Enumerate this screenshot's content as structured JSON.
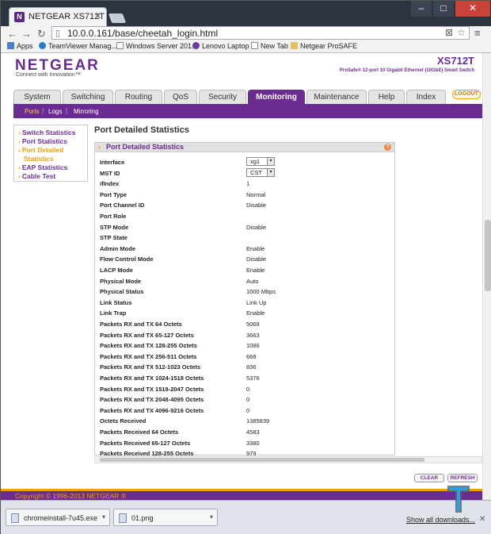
{
  "browser": {
    "tab_title": "NETGEAR XS712T",
    "url": "10.0.0.161/base/cheetah_login.html",
    "bookmarks": [
      "Apps",
      "TeamViewer Manag...",
      "Windows Server 201...",
      "Lenovo Laptop",
      "New Tab",
      "Netgear ProSAFE"
    ]
  },
  "header": {
    "logo": "NETGEAR",
    "tagline": "Connect with Innovation™",
    "model": "XS712T",
    "model_desc": "ProSafe® 12-port 10 Gigabit Ethernet (10GbE) Smart Switch",
    "logout": "LOGOUT"
  },
  "main_tabs": [
    {
      "label": "System"
    },
    {
      "label": "Switching"
    },
    {
      "label": "Routing"
    },
    {
      "label": "QoS"
    },
    {
      "label": "Security"
    },
    {
      "label": "Monitoring"
    },
    {
      "label": "Maintenance"
    },
    {
      "label": "Help"
    },
    {
      "label": "Index"
    }
  ],
  "sub_nav": [
    "Ports",
    "Logs",
    "Mirroring"
  ],
  "sidebar": {
    "items": [
      "Switch Statistics",
      "Port Statistics",
      "Port Detailed",
      "Statistics",
      "EAP Statistics",
      "Cable Test"
    ]
  },
  "content": {
    "title": "Port Detailed Statistics",
    "panel_title": "Port Detailed Statistics",
    "interface_value": "xg1",
    "mstid_value": "CST",
    "rows": [
      {
        "label": "Interface",
        "value": ""
      },
      {
        "label": "MST ID",
        "value": ""
      },
      {
        "label": "ifIndex",
        "value": "1"
      },
      {
        "label": "Port Type",
        "value": "Normal"
      },
      {
        "label": "Port Channel ID",
        "value": "Disable"
      },
      {
        "label": "Port Role",
        "value": ""
      },
      {
        "label": "STP Mode",
        "value": "Disable"
      },
      {
        "label": "STP State",
        "value": ""
      },
      {
        "label": "Admin Mode",
        "value": "Enable"
      },
      {
        "label": "Flow Control Mode",
        "value": "Disable"
      },
      {
        "label": "LACP Mode",
        "value": "Enable"
      },
      {
        "label": "Physical Mode",
        "value": "Auto"
      },
      {
        "label": "Physical Status",
        "value": "1000 Mbps"
      },
      {
        "label": "Link Status",
        "value": "Link Up"
      },
      {
        "label": "Link Trap",
        "value": "Enable"
      },
      {
        "label": "Packets RX and TX 64 Octets",
        "value": "5069"
      },
      {
        "label": "Packets RX and TX 65-127 Octets",
        "value": "3663"
      },
      {
        "label": "Packets RX and TX 128-255 Octets",
        "value": "1086"
      },
      {
        "label": "Packets RX and TX 256-511 Octets",
        "value": "668"
      },
      {
        "label": "Packets RX and TX 512-1023 Octets",
        "value": "836"
      },
      {
        "label": "Packets RX and TX 1024-1518 Octets",
        "value": "5376"
      },
      {
        "label": "Packets RX and TX 1519-2047 Octets",
        "value": "0"
      },
      {
        "label": "Packets RX and TX 2048-4095 Octets",
        "value": "0"
      },
      {
        "label": "Packets RX and TX 4096-9216 Octets",
        "value": "0"
      },
      {
        "label": "Octets Received",
        "value": "1385839"
      },
      {
        "label": "Packets Received 64 Octets",
        "value": "4583"
      },
      {
        "label": "Packets Received 65-127 Octets",
        "value": "3380"
      },
      {
        "label": "Packets Received 128-255 Octets",
        "value": "979"
      }
    ]
  },
  "buttons": {
    "clear": "CLEAR",
    "refresh": "REFRESH"
  },
  "footer": "Copyright © 1996-2013 NETGEAR ®",
  "downloads": {
    "items": [
      "chromeinstall-7u45.exe",
      "01.png"
    ],
    "show_all": "Show all downloads..."
  },
  "colors": {
    "brand": "#6b2c91",
    "accent": "#f0a000"
  }
}
